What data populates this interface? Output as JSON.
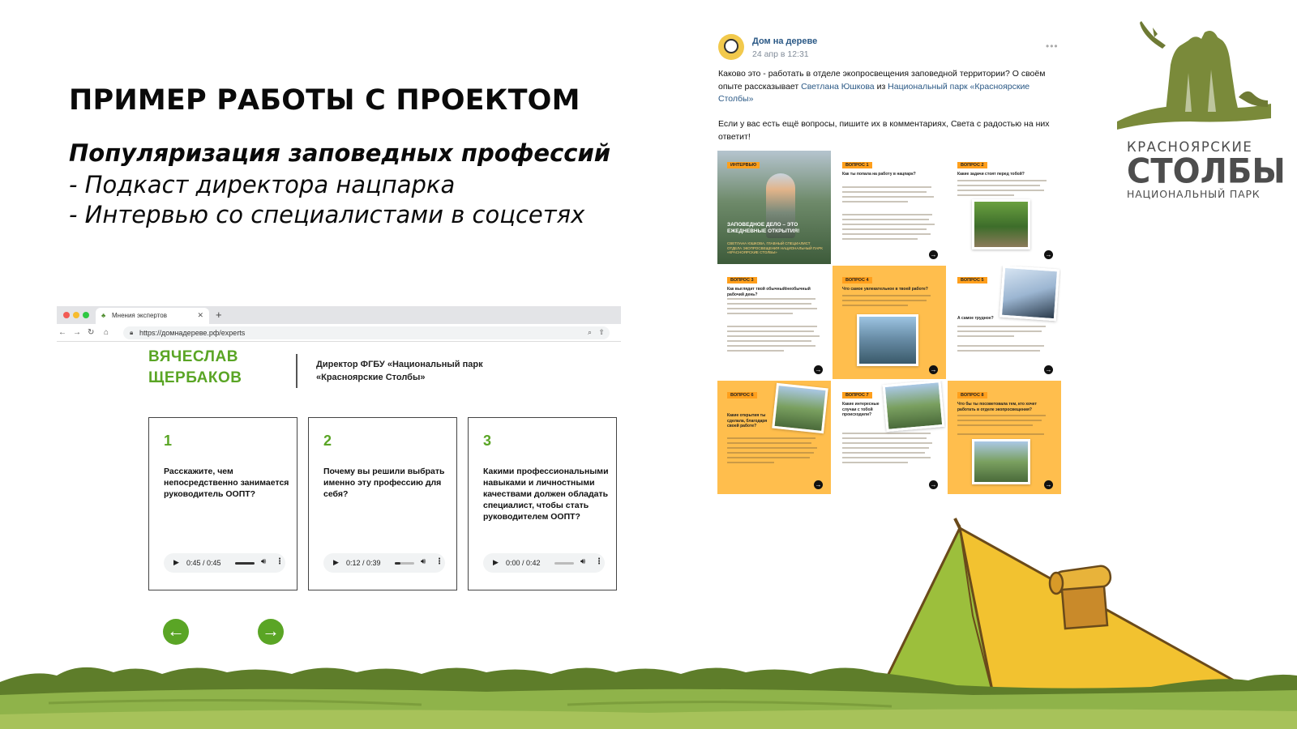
{
  "slide": {
    "title": "ПРИМЕР РАБОТЫ С ПРОЕКТОМ",
    "subtitle": "Популяризация заповедных профессий",
    "bullets": [
      "- Подкаст директора нацпарка",
      "- Интервью со специалистами в соцсетях"
    ]
  },
  "browser": {
    "tab_title": "Мнения экспертов",
    "tab_icon": "tree-icon",
    "url": "https://домнадереве.рф/experts"
  },
  "expert": {
    "name_line1": "ВЯЧЕСЛАВ",
    "name_line2": "ЩЕРБАКОВ",
    "role": "Директор ФГБУ «Национальный парк «Красноярские Столбы»"
  },
  "questions": [
    {
      "num": "1",
      "text": "Расскажите, чем непосредственно занимается руководитель ООПТ?",
      "time": "0:45 / 0:45",
      "progress": 1.0
    },
    {
      "num": "2",
      "text": "Почему вы решили выбрать именно эту профессию для себя?",
      "time": "0:12 / 0:39",
      "progress": 0.31
    },
    {
      "num": "3",
      "text": "Какими профессиональными навыками и личностными качествами должен обладать специалист, чтобы стать руководителем ООПТ?",
      "time": "0:00 / 0:42",
      "progress": 0.0
    }
  ],
  "post": {
    "author": "Дом на дереве",
    "date": "24 апр в 12:31",
    "text_start": "Каково это - работать в отделе экопросвещения заповедной территории? О своём опыте рассказывает ",
    "link1": "Светлана Юшкова",
    "text_mid": " из ",
    "link2": "Национальный парк «Красноярские Столбы»",
    "text2": "Если у вас есть ещё вопросы, пишите их в комментариях, Света с радостью на них ответит!",
    "tiles": [
      {
        "badge": "ИНТЕРВЬЮ",
        "quote": "ЗАПОВЕДНОЕ ДЕЛО – ЭТО ЕЖЕДНЕВНЫЕ ОТКРЫТИЯ!",
        "caption": "СВЕТЛАНА ЮШКОВА, ГЛАВНЫЙ СПЕЦИАЛИСТ ОТДЕЛА ЭКОПРОСВЕЩЕНИЯ НАЦИОНАЛЬНЫЙ ПАРК «КРАСНОЯРСКИЕ СТОЛБЫ»"
      },
      {
        "badge": "ВОПРОС 1",
        "question": "Как ты попала на работу в нацпарк?"
      },
      {
        "badge": "ВОПРОС 2",
        "question": "Какие задачи стоят перед тобой?"
      },
      {
        "badge": "ВОПРОС 3",
        "question": "Как выглядит твой обычный/необычный рабочий день?"
      },
      {
        "badge": "ВОПРОС 4",
        "question": "Что самое увлекательное в твоей работе?"
      },
      {
        "badge": "ВОПРОС 5",
        "question": "А самое трудное?"
      },
      {
        "badge": "ВОПРОС 6",
        "question": "Какие открытия ты сделала, благодаря своей работе?"
      },
      {
        "badge": "ВОПРОС 7",
        "question": "Какие интересные случаи с тобой происходили?"
      },
      {
        "badge": "ВОПРОС 8",
        "question": "Что бы ты посоветовала тем, кто хочет работать в отделе экопросвещения?"
      }
    ]
  },
  "logo": {
    "line1": "КРАСНОЯРСКИЕ",
    "line2": "СТОЛБЫ",
    "line3": "НАЦИОНАЛЬНЫЙ ПАРК"
  },
  "colors": {
    "green": "#5aa525",
    "orange": "#ffbe4d",
    "vk_link": "#2a5885",
    "logo_olive": "#7a8a3a"
  }
}
